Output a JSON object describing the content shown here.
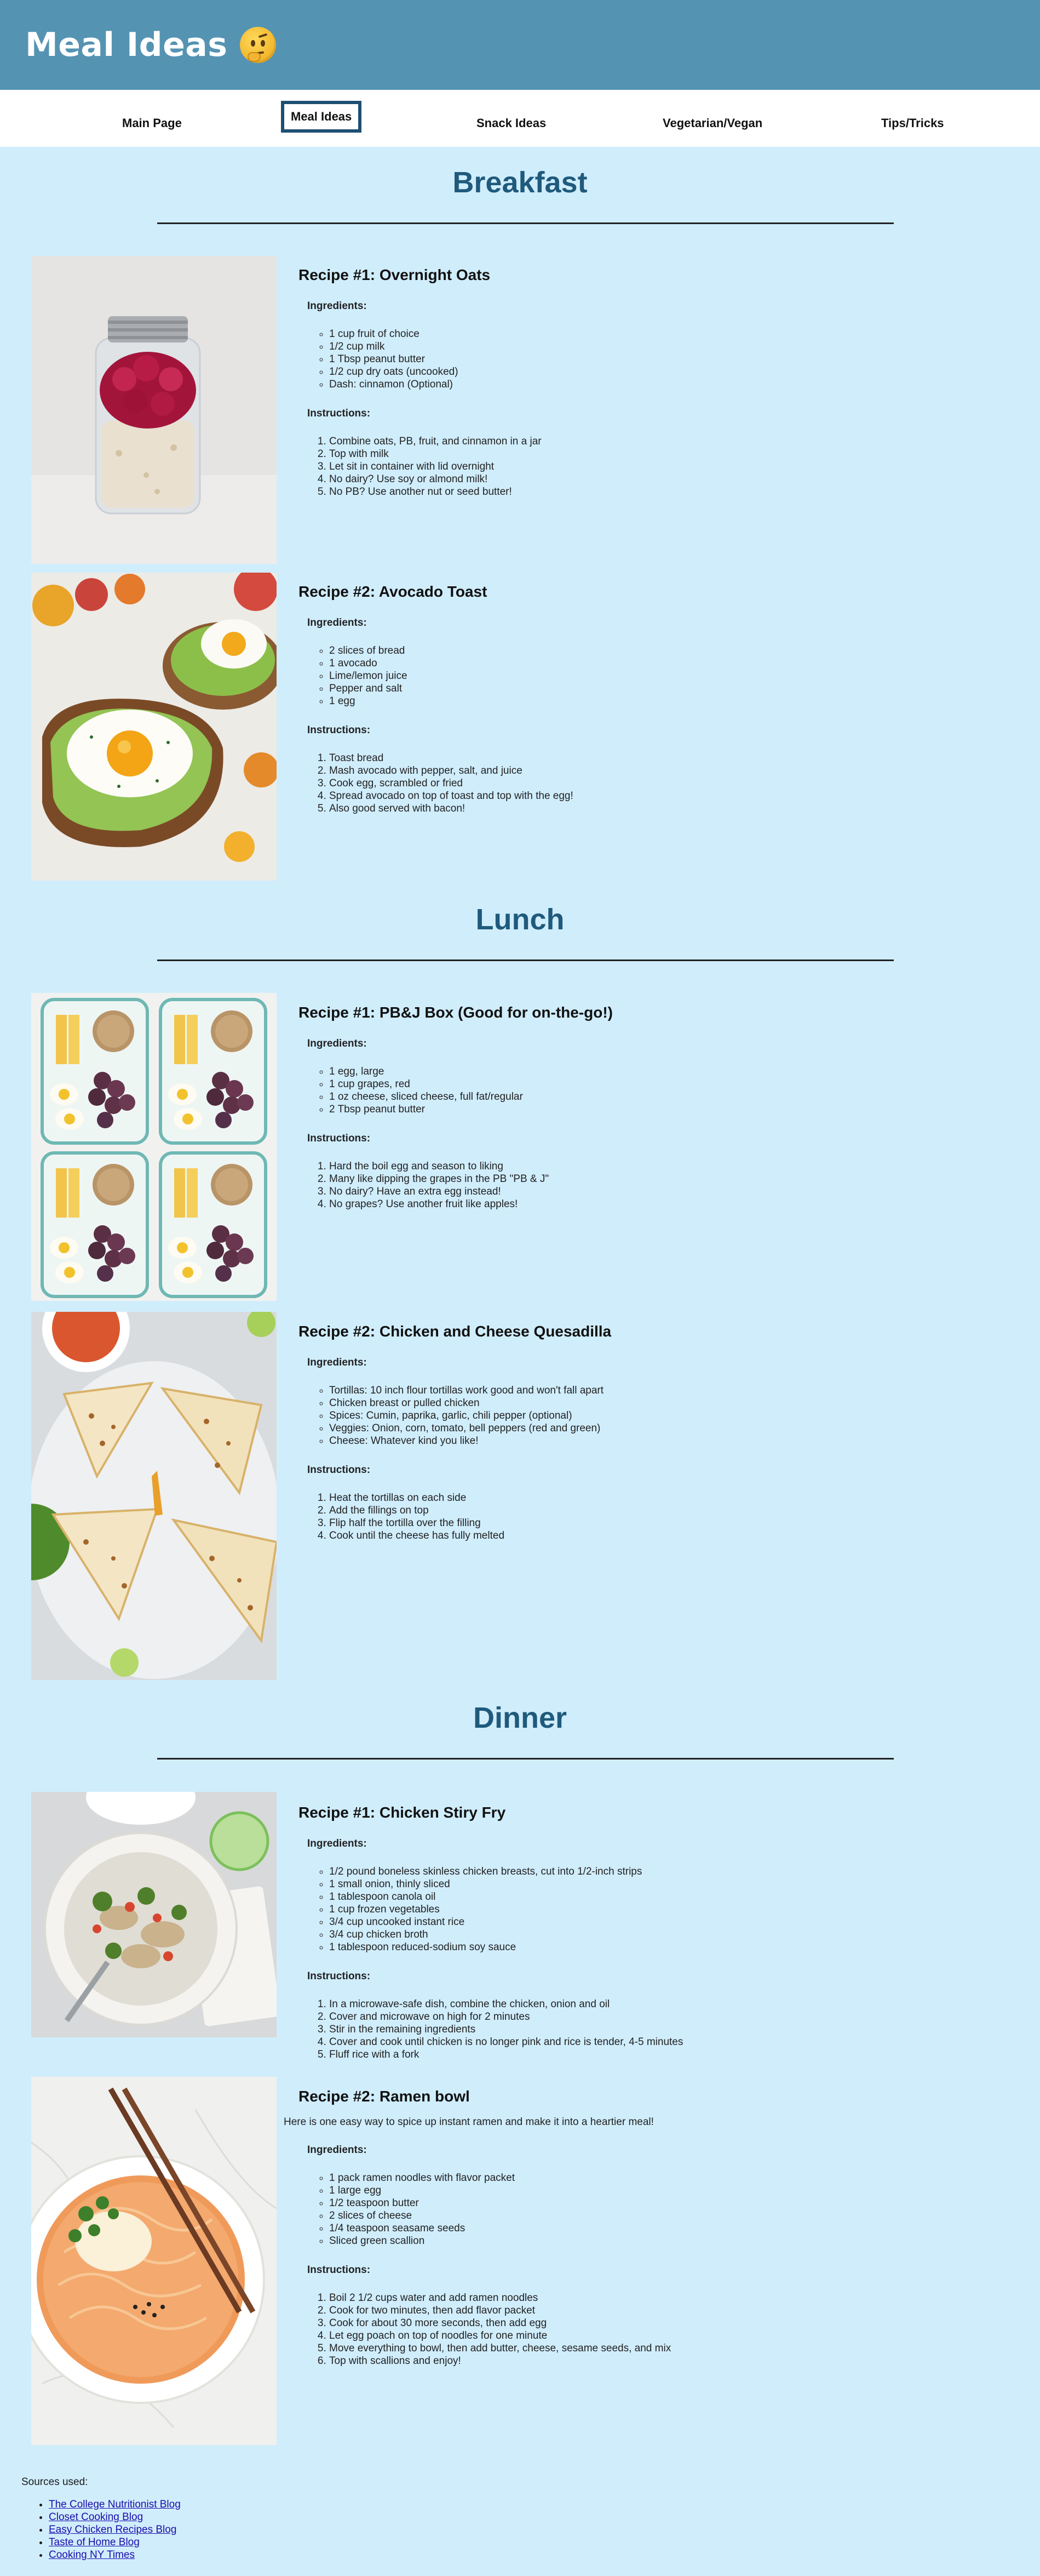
{
  "site": {
    "title": "Meal Ideas",
    "title_emoji": "thinking-face"
  },
  "nav": {
    "items": [
      {
        "label": "Main Page",
        "active": false
      },
      {
        "label": "Meal Ideas",
        "active": true
      },
      {
        "label": "Snack Ideas",
        "active": false
      },
      {
        "label": "Vegetarian/Vegan",
        "active": false
      },
      {
        "label": "Tips/Tricks",
        "active": false
      }
    ]
  },
  "sections": [
    {
      "title": "Breakfast",
      "recipes": [
        {
          "title": "Recipe #1: Overnight Oats",
          "ingredients_label": "Ingredients:",
          "ingredients": [
            "1 cup fruit of choice",
            "1/2 cup milk",
            "1 Tbsp peanut butter",
            "1/2 cup dry oats (uncooked)",
            "Dash: cinnamon (Optional)"
          ],
          "instructions_label": "Instructions:",
          "instructions": [
            "Combine oats, PB, fruit, and cinnamon in a jar",
            "Top with milk",
            "Let sit in container with lid overnight",
            "No dairy? Use soy or almond milk!",
            "No PB? Use another nut or seed butter!"
          ]
        },
        {
          "title": "Recipe #2: Avocado Toast",
          "ingredients_label": "Ingredients:",
          "ingredients": [
            "2 slices of bread",
            "1 avocado",
            "Lime/lemon juice",
            "Pepper and salt",
            "1 egg"
          ],
          "instructions_label": "Instructions:",
          "instructions": [
            "Toast bread",
            "Mash avocado with pepper, salt, and juice",
            "Cook egg, scrambled or fried",
            "Spread avocado on top of toast and top with the egg!",
            "Also good served with bacon!"
          ]
        }
      ]
    },
    {
      "title": "Lunch",
      "recipes": [
        {
          "title": "Recipe #1: PB&J Box (Good for on-the-go!)",
          "ingredients_label": "Ingredients:",
          "ingredients": [
            "1 egg, large",
            "1 cup grapes, red",
            "1 oz cheese, sliced cheese, full fat/regular",
            "2 Tbsp peanut butter"
          ],
          "instructions_label": "Instructions:",
          "instructions": [
            "Hard the boil egg and season to liking",
            "Many like dipping the grapes in the PB \"PB & J\"",
            "No dairy? Have an extra egg instead!",
            "No grapes? Use another fruit like apples!"
          ]
        },
        {
          "title": "Recipe #2: Chicken and Cheese Quesadilla",
          "ingredients_label": "Ingredients:",
          "ingredients": [
            "Tortillas: 10 inch flour tortillas work good and won't fall apart",
            "Chicken breast or pulled chicken",
            "Spices: Cumin, paprika, garlic, chili pepper (optional)",
            "Veggies: Onion, corn, tomato, bell peppers (red and green)",
            "Cheese: Whatever kind you like!"
          ],
          "instructions_label": "Instructions:",
          "instructions": [
            "Heat the tortillas on each side",
            "Add the fillings on top",
            "Flip half the tortilla over the filling",
            "Cook until the cheese has fully melted"
          ]
        }
      ]
    },
    {
      "title": "Dinner",
      "recipes": [
        {
          "title": "Recipe #1: Chicken Stiry Fry",
          "ingredients_label": "Ingredients:",
          "ingredients": [
            "1/2 pound boneless skinless chicken breasts, cut into 1/2-inch strips",
            "1 small onion, thinly sliced",
            "1 tablespoon canola oil",
            "1 cup frozen vegetables",
            "3/4 cup uncooked instant rice",
            "3/4 cup chicken broth",
            "1 tablespoon reduced-sodium soy sauce"
          ],
          "instructions_label": "Instructions:",
          "instructions": [
            "In a microwave-safe dish, combine the chicken, onion and oil",
            "Cover and microwave on high for 2 minutes",
            "Stir in the remaining ingredients",
            "Cover and cook until chicken is no longer pink and rice is tender, 4-5 minutes",
            "Fluff rice with a fork"
          ]
        },
        {
          "title": "Recipe #2: Ramen bowl",
          "intro": "Here is one easy way to spice up instant ramen and make it into a heartier meal!",
          "ingredients_label": "Ingredients:",
          "ingredients": [
            "1 pack ramen noodles with flavor packet",
            "1 large egg",
            "1/2 teaspoon butter",
            "2 slices of cheese",
            "1/4 teaspoon seasame seeds",
            "Sliced green scallion"
          ],
          "instructions_label": "Instructions:",
          "instructions": [
            "Boil 2 1/2 cups water and add ramen noodles",
            "Cook for two minutes, then add flavor packet",
            "Cook for about 30 more seconds, then add egg",
            "Let egg poach on top of noodles for one minute",
            "Move everything to bowl, then add butter, cheese, sesame seeds, and mix",
            "Top with scallions and enjoy!"
          ]
        }
      ]
    }
  ],
  "sources": {
    "label": "Sources used:",
    "links": [
      "The College Nutritionist Blog",
      "Closet Cooking Blog",
      "Easy Chicken Recipes Blog",
      "Taste of Home Blog",
      "Cooking NY Times"
    ]
  }
}
